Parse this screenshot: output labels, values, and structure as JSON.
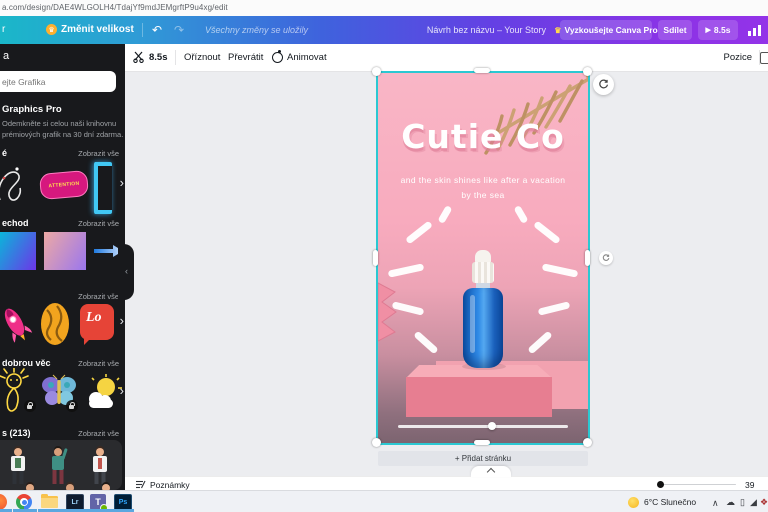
{
  "browser": {
    "url": "a.com/design/DAE4WLGOLH4/TdajYf9mdJEMgrftP9u4xg/edit"
  },
  "header": {
    "menu_fragment": "r",
    "resize": "Změnit velikost",
    "saved": "Všechny změny se uložily",
    "title": "Návrh bez názvu – Your Story",
    "pro": "Vyzkoušejte Canva Pro",
    "share": "Sdílet",
    "duration": "8.5s"
  },
  "toolbar": {
    "duration": "8.5s",
    "crop": "Oříznout",
    "flip": "Převrátit",
    "animate": "Animovat",
    "position": "Pozice"
  },
  "sidebar": {
    "title_fragment": "a",
    "search_placeholder": "ejte Grafika",
    "promo_title": "Graphics Pro",
    "promo_line1": "Odemkněte si celou naši knihovnu",
    "promo_line2": "prémiových grafik na 30 dní zdarma.",
    "show_all": "Zobrazit vše",
    "sections": [
      {
        "label": "é"
      },
      {
        "label": "echod"
      },
      {
        "label": ""
      },
      {
        "label": "dobrou věc"
      },
      {
        "label": "s (213)"
      }
    ],
    "attention_text": "ATTENTION",
    "bubble_text": "Lo"
  },
  "poster": {
    "title": "Cutie Co",
    "subtitle1": "and the skin shines like after a vacation",
    "subtitle2": "by the sea"
  },
  "canvas": {
    "add_page": "+ Přidat stránku"
  },
  "bottom_bar": {
    "notes": "Poznámky",
    "zoom": "39"
  },
  "taskbar": {
    "weather": "6°C Slunečno"
  },
  "colors": {
    "accent": "#2bc8d2",
    "header_start": "#1ab7c9",
    "header_end": "#9333e8",
    "poster_pink": "#f7a9bd",
    "bottle_blue": "#1d6fd4"
  }
}
